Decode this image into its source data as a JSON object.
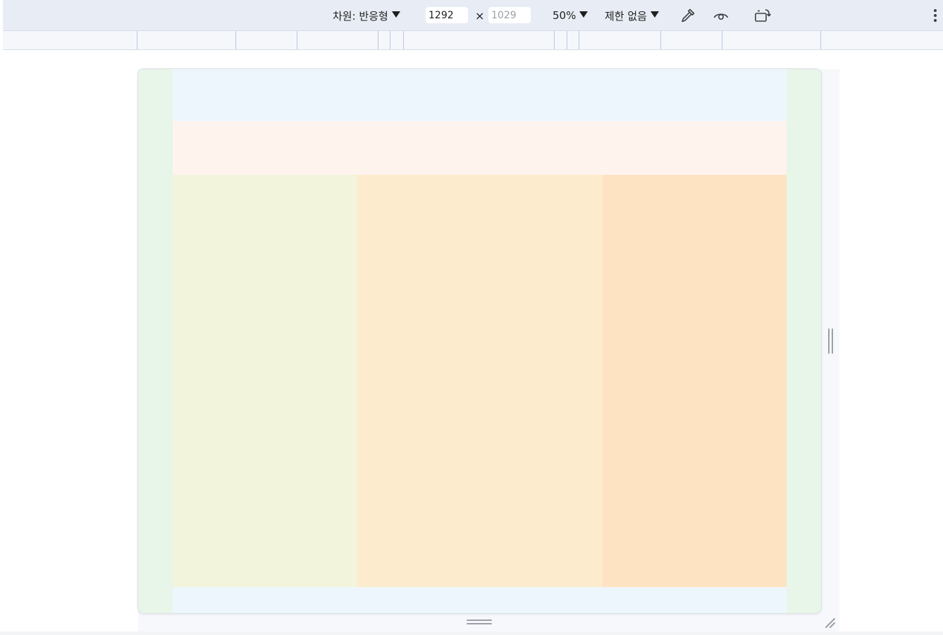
{
  "toolbar": {
    "dimensions_label": "차원: 반응형",
    "width_value": "1292",
    "height_placeholder": "1029",
    "times_sign": "×",
    "zoom_label": "50%",
    "throttle_label": "제한 없음",
    "icons": [
      "eyedropper-icon",
      "eye-icon",
      "rotate-icon",
      "more-vert-icon"
    ]
  },
  "colors": {
    "toolbar_bg": "#e8edf5",
    "ruler_mark": "#b8c7e6",
    "side_green": "#e8f5e9",
    "header_blue": "#eef6fd",
    "banner_peach": "#fff3ee",
    "col_left": "#f3f4dc",
    "col_mid": "#fdebcd",
    "col_right": "#fde3c2",
    "footer_blue": "#eef6fd"
  }
}
